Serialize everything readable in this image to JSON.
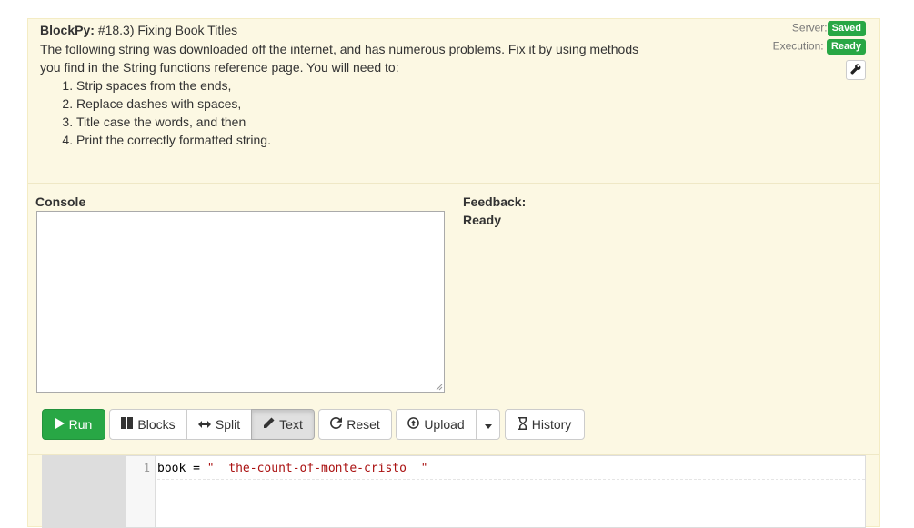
{
  "header": {
    "app_name": "BlockPy:",
    "assignment_title": "#18.3) Fixing Book Titles",
    "instructions_line1": "The following string was downloaded off the internet, and has numerous problems. Fix it by using methods",
    "instructions_line2": "you find in the String functions reference page. You will need to:",
    "steps": [
      "Strip spaces from the ends,",
      "Replace dashes with spaces,",
      "Title case the words, and then",
      "Print the correctly formatted string."
    ]
  },
  "status": {
    "server_label": "Server:",
    "server_value": "Saved",
    "execution_label": "Execution:",
    "execution_value": "Ready",
    "badge_color": "#28a745"
  },
  "console": {
    "label": "Console",
    "output": ""
  },
  "feedback": {
    "label": "Feedback:",
    "status": "Ready"
  },
  "toolbar": {
    "run_label": "Run",
    "blocks_label": "Blocks",
    "split_label": "Split",
    "text_label": "Text",
    "reset_label": "Reset",
    "upload_label": "Upload",
    "history_label": "History",
    "active_mode": "Text"
  },
  "editor": {
    "lines": [
      {
        "number": "1",
        "var": "book",
        "op": " = ",
        "string": "\"  the-count-of-monte-cristo  \""
      }
    ]
  },
  "icons": {
    "wrench": "wrench-icon",
    "run": "play-icon",
    "blocks": "th-large-icon",
    "split": "resize-horizontal-icon",
    "text": "pencil-icon",
    "reset": "refresh-icon",
    "upload": "upload-icon",
    "caret": "caret-down-icon",
    "history": "hourglass-icon"
  }
}
